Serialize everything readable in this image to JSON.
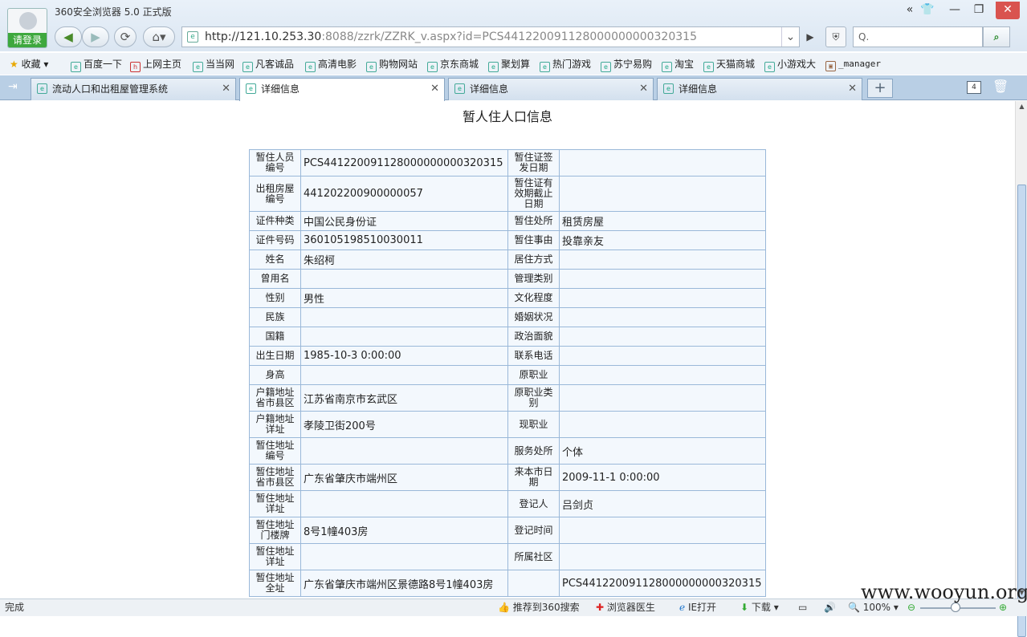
{
  "browser": {
    "app_title": "360安全浏览器 5.0 正式版",
    "login_label": "请登录",
    "url_host": "http://121.10.253.30",
    "url_rest": ":8088/zzrk/ZZRK_v.aspx?id=PCS441220091128000000000320315",
    "search_placeholder": "Q.",
    "window_buttons": [
      "«",
      "👕",
      "—",
      "❐",
      "✕"
    ]
  },
  "bookmarks": [
    "收藏",
    "百度一下",
    "上网主页",
    "当当网",
    "凡客诚品",
    "高清电影",
    "购物网站",
    "京东商城",
    "聚划算",
    "热门游戏",
    "苏宁易购",
    "淘宝",
    "天猫商城",
    "小游戏大",
    "_manager"
  ],
  "tabs": [
    {
      "label": "流动人口和出租屋管理系统"
    },
    {
      "label": "详细信息"
    },
    {
      "label": "详细信息"
    },
    {
      "label": "详细信息"
    }
  ],
  "tab_count": "4",
  "page": {
    "heading": "暂人住人口信息",
    "rows": [
      [
        "暂住人员编号",
        "PCS441220091128000000000320315",
        "暂住证签发日期",
        ""
      ],
      [
        "出租房屋编号",
        "441202200900000057",
        "暂住证有效期截止日期",
        ""
      ],
      [
        "证件种类",
        "中国公民身份证",
        "暂住处所",
        "租赁房屋"
      ],
      [
        "证件号码",
        "360105198510030011",
        "暂住事由",
        "投靠亲友"
      ],
      [
        "姓名",
        "朱绍柯",
        "居住方式",
        ""
      ],
      [
        "曾用名",
        "",
        "管理类别",
        ""
      ],
      [
        "性别",
        "男性",
        "文化程度",
        ""
      ],
      [
        "民族",
        "",
        "婚姻状况",
        ""
      ],
      [
        "国籍",
        "",
        "政治面貌",
        ""
      ],
      [
        "出生日期",
        "1985-10-3 0:00:00",
        "联系电话",
        ""
      ],
      [
        "身高",
        "",
        "原职业",
        ""
      ],
      [
        "户籍地址省市县区",
        "江苏省南京市玄武区",
        "原职业类别",
        ""
      ],
      [
        "户籍地址详址",
        "孝陵卫街200号",
        "现职业",
        ""
      ],
      [
        "暂住地址编号",
        "",
        "服务处所",
        "个体"
      ],
      [
        "暂住地址省市县区",
        "广东省肇庆市端州区",
        "来本市日期",
        "2009-11-1 0:00:00"
      ],
      [
        "暂住地址详址",
        "",
        "登记人",
        "吕剑贞"
      ],
      [
        "暂住地址门楼牌",
        "8号1幢403房",
        "登记时间",
        ""
      ],
      [
        "暂住地址详址",
        "",
        "所属社区",
        ""
      ],
      [
        "暂住地址全址",
        "广东省肇庆市端州区景德路8号1幢403房",
        "",
        "PCS441220091128000000000320315"
      ]
    ]
  },
  "status": {
    "left": "完成",
    "recommend": "推荐到360搜索",
    "doctor": "浏览器医生",
    "ie_open": "IE打开",
    "download": "下载",
    "zoom": "100%"
  },
  "watermark": "www.wooyun.org"
}
